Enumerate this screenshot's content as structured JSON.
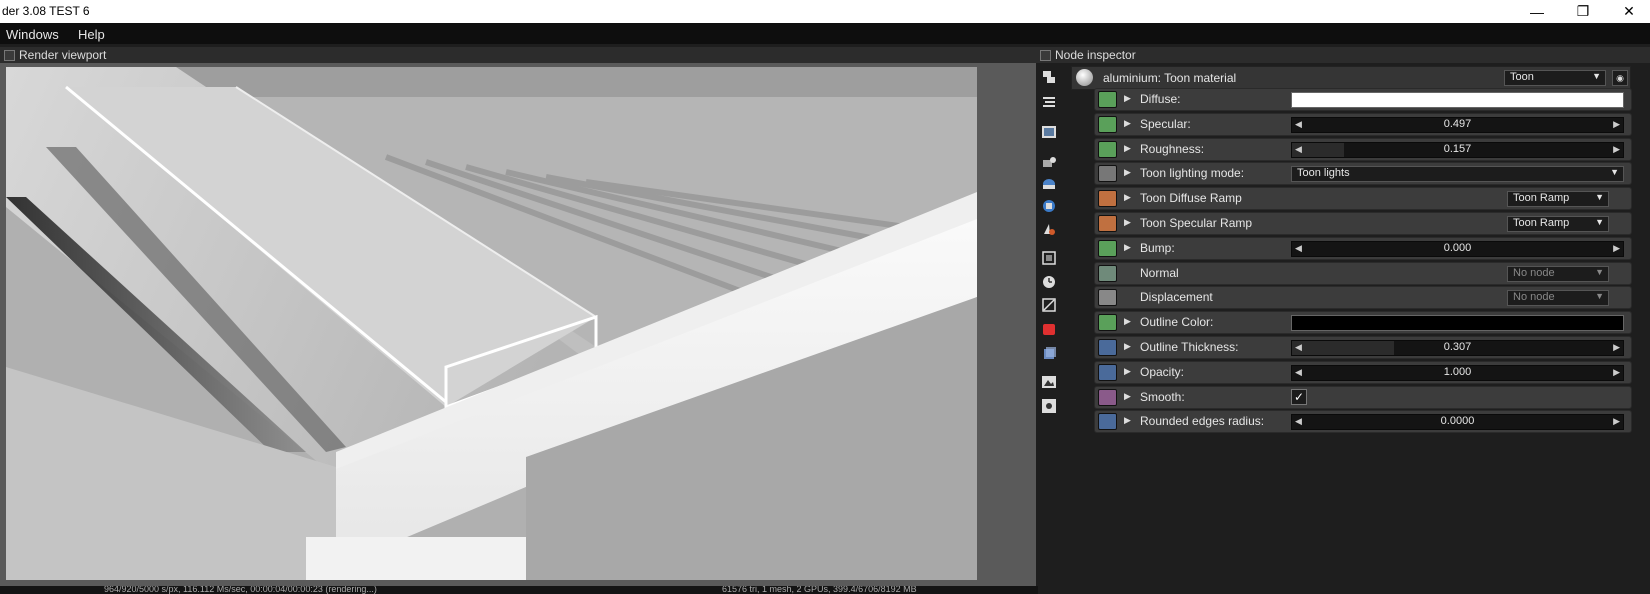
{
  "window": {
    "title": "der 3.08 TEST 6"
  },
  "menu": [
    "Windows",
    "Help"
  ],
  "viewport_panel": {
    "title": "Render viewport",
    "status_left": "964/920/5000 s/px, 116.112 Ms/sec, 00:00:04/00:00:23 (rendering...)",
    "status_right": "61576 tri, 1 mesh, 2 GPUs, 399.4/6706/8192 MB"
  },
  "inspector": {
    "title": "Node inspector",
    "node_name": "aluminium: Toon material",
    "node_type": "Toon",
    "rows": [
      {
        "label": "Diffuse:",
        "kind": "color",
        "color": "#ffffff",
        "icon_color": "#5aa05a"
      },
      {
        "label": "Specular:",
        "kind": "slider",
        "value": "0.497",
        "fraction": 0.0,
        "icon_color": "#5aa05a"
      },
      {
        "label": "Roughness:",
        "kind": "slider",
        "value": "0.157",
        "fraction": 0.157,
        "icon_color": "#5aa05a"
      },
      {
        "label": "Toon lighting mode:",
        "kind": "enum",
        "value": "Toon lights",
        "icon_color": "#777777"
      },
      {
        "label": "Toon Diffuse Ramp",
        "kind": "node",
        "value": "Toon Ramp",
        "icon_color": "#c07040"
      },
      {
        "label": "Toon Specular Ramp",
        "kind": "node",
        "value": "Toon Ramp",
        "icon_color": "#c07040"
      },
      {
        "label": "Bump:",
        "kind": "slider",
        "value": "0.000",
        "fraction": 0.0,
        "icon_color": "#5aa05a"
      },
      {
        "label": "Normal",
        "kind": "nonode",
        "value": "No node",
        "icon_color": "#6f8a7a"
      },
      {
        "label": "Displacement",
        "kind": "nonode",
        "value": "No node",
        "icon_color": "#888888"
      },
      {
        "label": "Outline Color:",
        "kind": "color",
        "color": "#000000",
        "icon_color": "#5aa05a"
      },
      {
        "label": "Outline Thickness:",
        "kind": "slider",
        "value": "0.307",
        "fraction": 0.307,
        "icon_color": "#4a6a9a"
      },
      {
        "label": "Opacity:",
        "kind": "slider",
        "value": "1.000",
        "fraction": 0.0,
        "icon_color": "#4a6a9a"
      },
      {
        "label": "Smooth:",
        "kind": "checkbox",
        "value": "✓",
        "icon_color": "#8a5a8a"
      },
      {
        "label": "Rounded edges radius:",
        "kind": "slider",
        "value": "0.0000",
        "fraction": 0.0,
        "icon_color": "#4a6a9a"
      }
    ]
  },
  "toolbar_icons": [
    "node-graph-icon",
    "outliner-icon",
    "image-icon",
    "camera-icon",
    "environment-icon",
    "render-target-icon",
    "material-icon",
    "film-icon",
    "clock-icon",
    "kernel-icon",
    "red-cube-icon",
    "blue-cube-icon",
    "picture-icon",
    "light-icon"
  ]
}
